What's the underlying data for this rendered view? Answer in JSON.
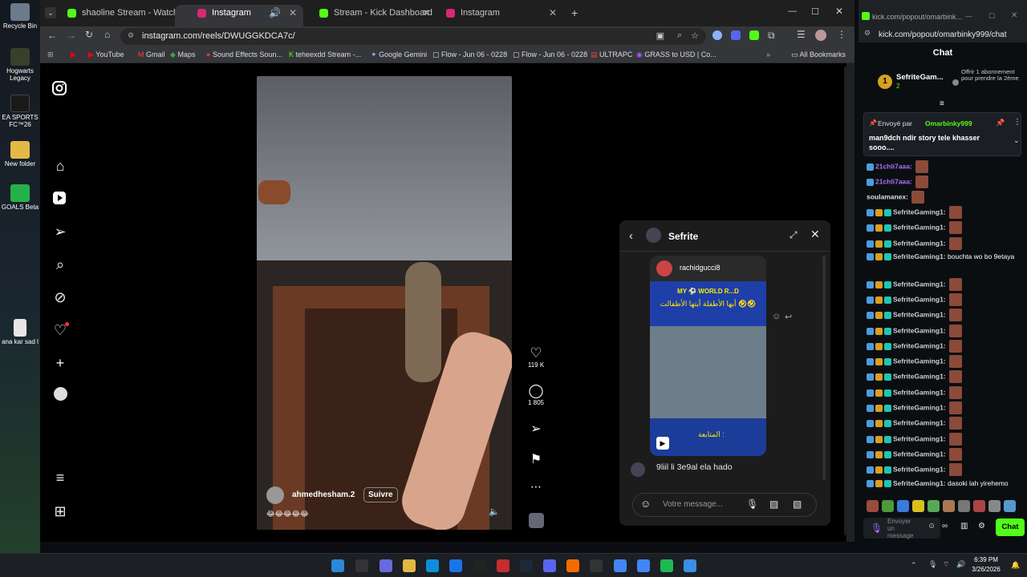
{
  "desktop": {
    "icons": [
      {
        "label": "Recycle Bin",
        "color": "#6b7a8c"
      },
      {
        "label": "Hogwarts Legacy",
        "color": "#38402a"
      },
      {
        "label": "EA SPORTS FC™26",
        "color": "#1a1a1a"
      },
      {
        "label": "New folder",
        "color": "#e3b845"
      },
      {
        "label": "GOALS Beta",
        "color": "#26b04a"
      },
      {
        "label": "ana kar sad l",
        "color": "#e6e6e6"
      }
    ]
  },
  "browser": {
    "tabs": [
      {
        "label": "shaoline Stream - Watch Live o",
        "color": "#53fc18"
      },
      {
        "label": "Instagram",
        "color": "#d62976"
      },
      {
        "label": "Stream - Kick Dashboard",
        "color": "#53fc18"
      },
      {
        "label": "Instagram",
        "color": "#d62976"
      }
    ],
    "url": "instagram.com/reels/DWUGGKDCA7c/",
    "bookmarks": [
      "YouTube",
      "Gmail",
      "Maps",
      "Sound Effects Soun...",
      "teheexdd Stream -...",
      "Google Gemini",
      "Flow - Jun 06 - 0228",
      "Flow - Jun 06 - 0228",
      "ULTRAPC",
      "GRASS to USD | Co..."
    ],
    "all_bookmarks": "All Bookmarks"
  },
  "reel": {
    "username": "ahmedhesham.2",
    "follow": "Suivre",
    "caption_emojis": "😂😂😂😂😂",
    "likes": "119 K",
    "comments": "1 805"
  },
  "dm": {
    "title": "Sefrite",
    "shared_user": "rachidgucci8",
    "meme_top": "MY ⚽ WORLD R...D",
    "meme_arabic": "أيها الأطفلة أيتها الأطفالت 🤣🤣",
    "meme_bottom": "المتابعة :",
    "message": "9liil li 3e9al ela hado",
    "input_placeholder": "Votre message..."
  },
  "kick": {
    "window_title": "kick.com/popout/omarbink...",
    "url": "kick.com/popout/omarbinky999/chat",
    "chat_title": "Chat",
    "top_user": "SefriteGam...",
    "top_count": "2",
    "offer": "Offrir 1 abonnement pour prendre la 2ème",
    "pinned_by_label": "Envoyé par",
    "pinned_by": "Omarbinky999",
    "pinned_text": "man9dch ndir story tele khasser sooo....",
    "messages": [
      {
        "user": "21chli7aaa",
        "text": "",
        "color": "#a970ff",
        "badges": 1
      },
      {
        "user": "21chli7aaa",
        "text": "",
        "color": "#a970ff",
        "badges": 1
      },
      {
        "user": "soulamanex",
        "text": "",
        "color": "#e0e0e0",
        "badges": 0
      },
      {
        "user": "SefriteGaming1",
        "text": "",
        "color": "#cfcfcf",
        "badges": 3
      },
      {
        "user": "SefriteGaming1",
        "text": "",
        "color": "#cfcfcf",
        "badges": 3
      },
      {
        "user": "SefriteGaming1",
        "text": "",
        "color": "#cfcfcf",
        "badges": 3
      },
      {
        "user": "SefriteGaming1",
        "text": "bouchta wo bo 9etaya",
        "color": "#cfcfcf",
        "badges": 3
      },
      {
        "user": "SefriteGaming1",
        "text": "",
        "color": "#cfcfcf",
        "badges": 3
      },
      {
        "user": "SefriteGaming1",
        "text": "",
        "color": "#cfcfcf",
        "badges": 3
      },
      {
        "user": "SefriteGaming1",
        "text": "",
        "color": "#cfcfcf",
        "badges": 3
      },
      {
        "user": "SefriteGaming1",
        "text": "",
        "color": "#cfcfcf",
        "badges": 3
      },
      {
        "user": "SefriteGaming1",
        "text": "",
        "color": "#cfcfcf",
        "badges": 3
      },
      {
        "user": "SefriteGaming1",
        "text": "",
        "color": "#cfcfcf",
        "badges": 3
      },
      {
        "user": "SefriteGaming1",
        "text": "",
        "color": "#cfcfcf",
        "badges": 3
      },
      {
        "user": "SefriteGaming1",
        "text": "",
        "color": "#cfcfcf",
        "badges": 3
      },
      {
        "user": "SefriteGaming1",
        "text": "",
        "color": "#cfcfcf",
        "badges": 3
      },
      {
        "user": "SefriteGaming1",
        "text": "",
        "color": "#cfcfcf",
        "badges": 3
      },
      {
        "user": "SefriteGaming1",
        "text": "",
        "color": "#cfcfcf",
        "badges": 3
      },
      {
        "user": "SefriteGaming1",
        "text": "",
        "color": "#cfcfcf",
        "badges": 3
      },
      {
        "user": "SefriteGaming1",
        "text": "",
        "color": "#cfcfcf",
        "badges": 3
      },
      {
        "user": "SefriteGaming1",
        "text": "dasoki lah yirehemo",
        "color": "#cfcfcf",
        "badges": 3
      }
    ],
    "send_placeholder": "Envoyer un message",
    "chat_button": "Chat",
    "accent": "#53fc18"
  },
  "taskbar": {
    "time": "6:39 PM",
    "date": "3/26/2026"
  }
}
